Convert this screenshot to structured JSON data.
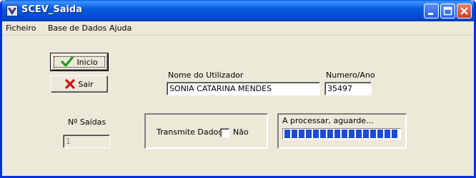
{
  "window": {
    "title": "SCEV_Saida",
    "colors": {
      "titlebar": "#0a5ae0",
      "face": "#ece9d8",
      "progress": "#1c4bd6"
    }
  },
  "titlebar_buttons": {
    "minimize_icon": "minimize-icon",
    "maximize_icon": "maximize-icon",
    "close_icon": "close-icon"
  },
  "menu": {
    "items": [
      "Ficheiro",
      "Base de Dados",
      "Ajuda"
    ]
  },
  "buttons": {
    "inicio": {
      "label": "Inicio",
      "icon": "checkmark-icon"
    },
    "sair": {
      "label": "Sair",
      "icon": "x-icon"
    }
  },
  "user": {
    "name_label": "Nome do Utilizador",
    "name_value": "SONIA CATARINA MENDES",
    "number_label": "Numero/Ano",
    "number_value": "35497"
  },
  "exits": {
    "label": "Nº Saídas",
    "value": "1"
  },
  "transmit": {
    "label": "Transmite Dados",
    "checkbox_label": "Não",
    "checked": false
  },
  "status": {
    "text": "A processar, aguarde...",
    "progress_fraction": 1.0
  }
}
